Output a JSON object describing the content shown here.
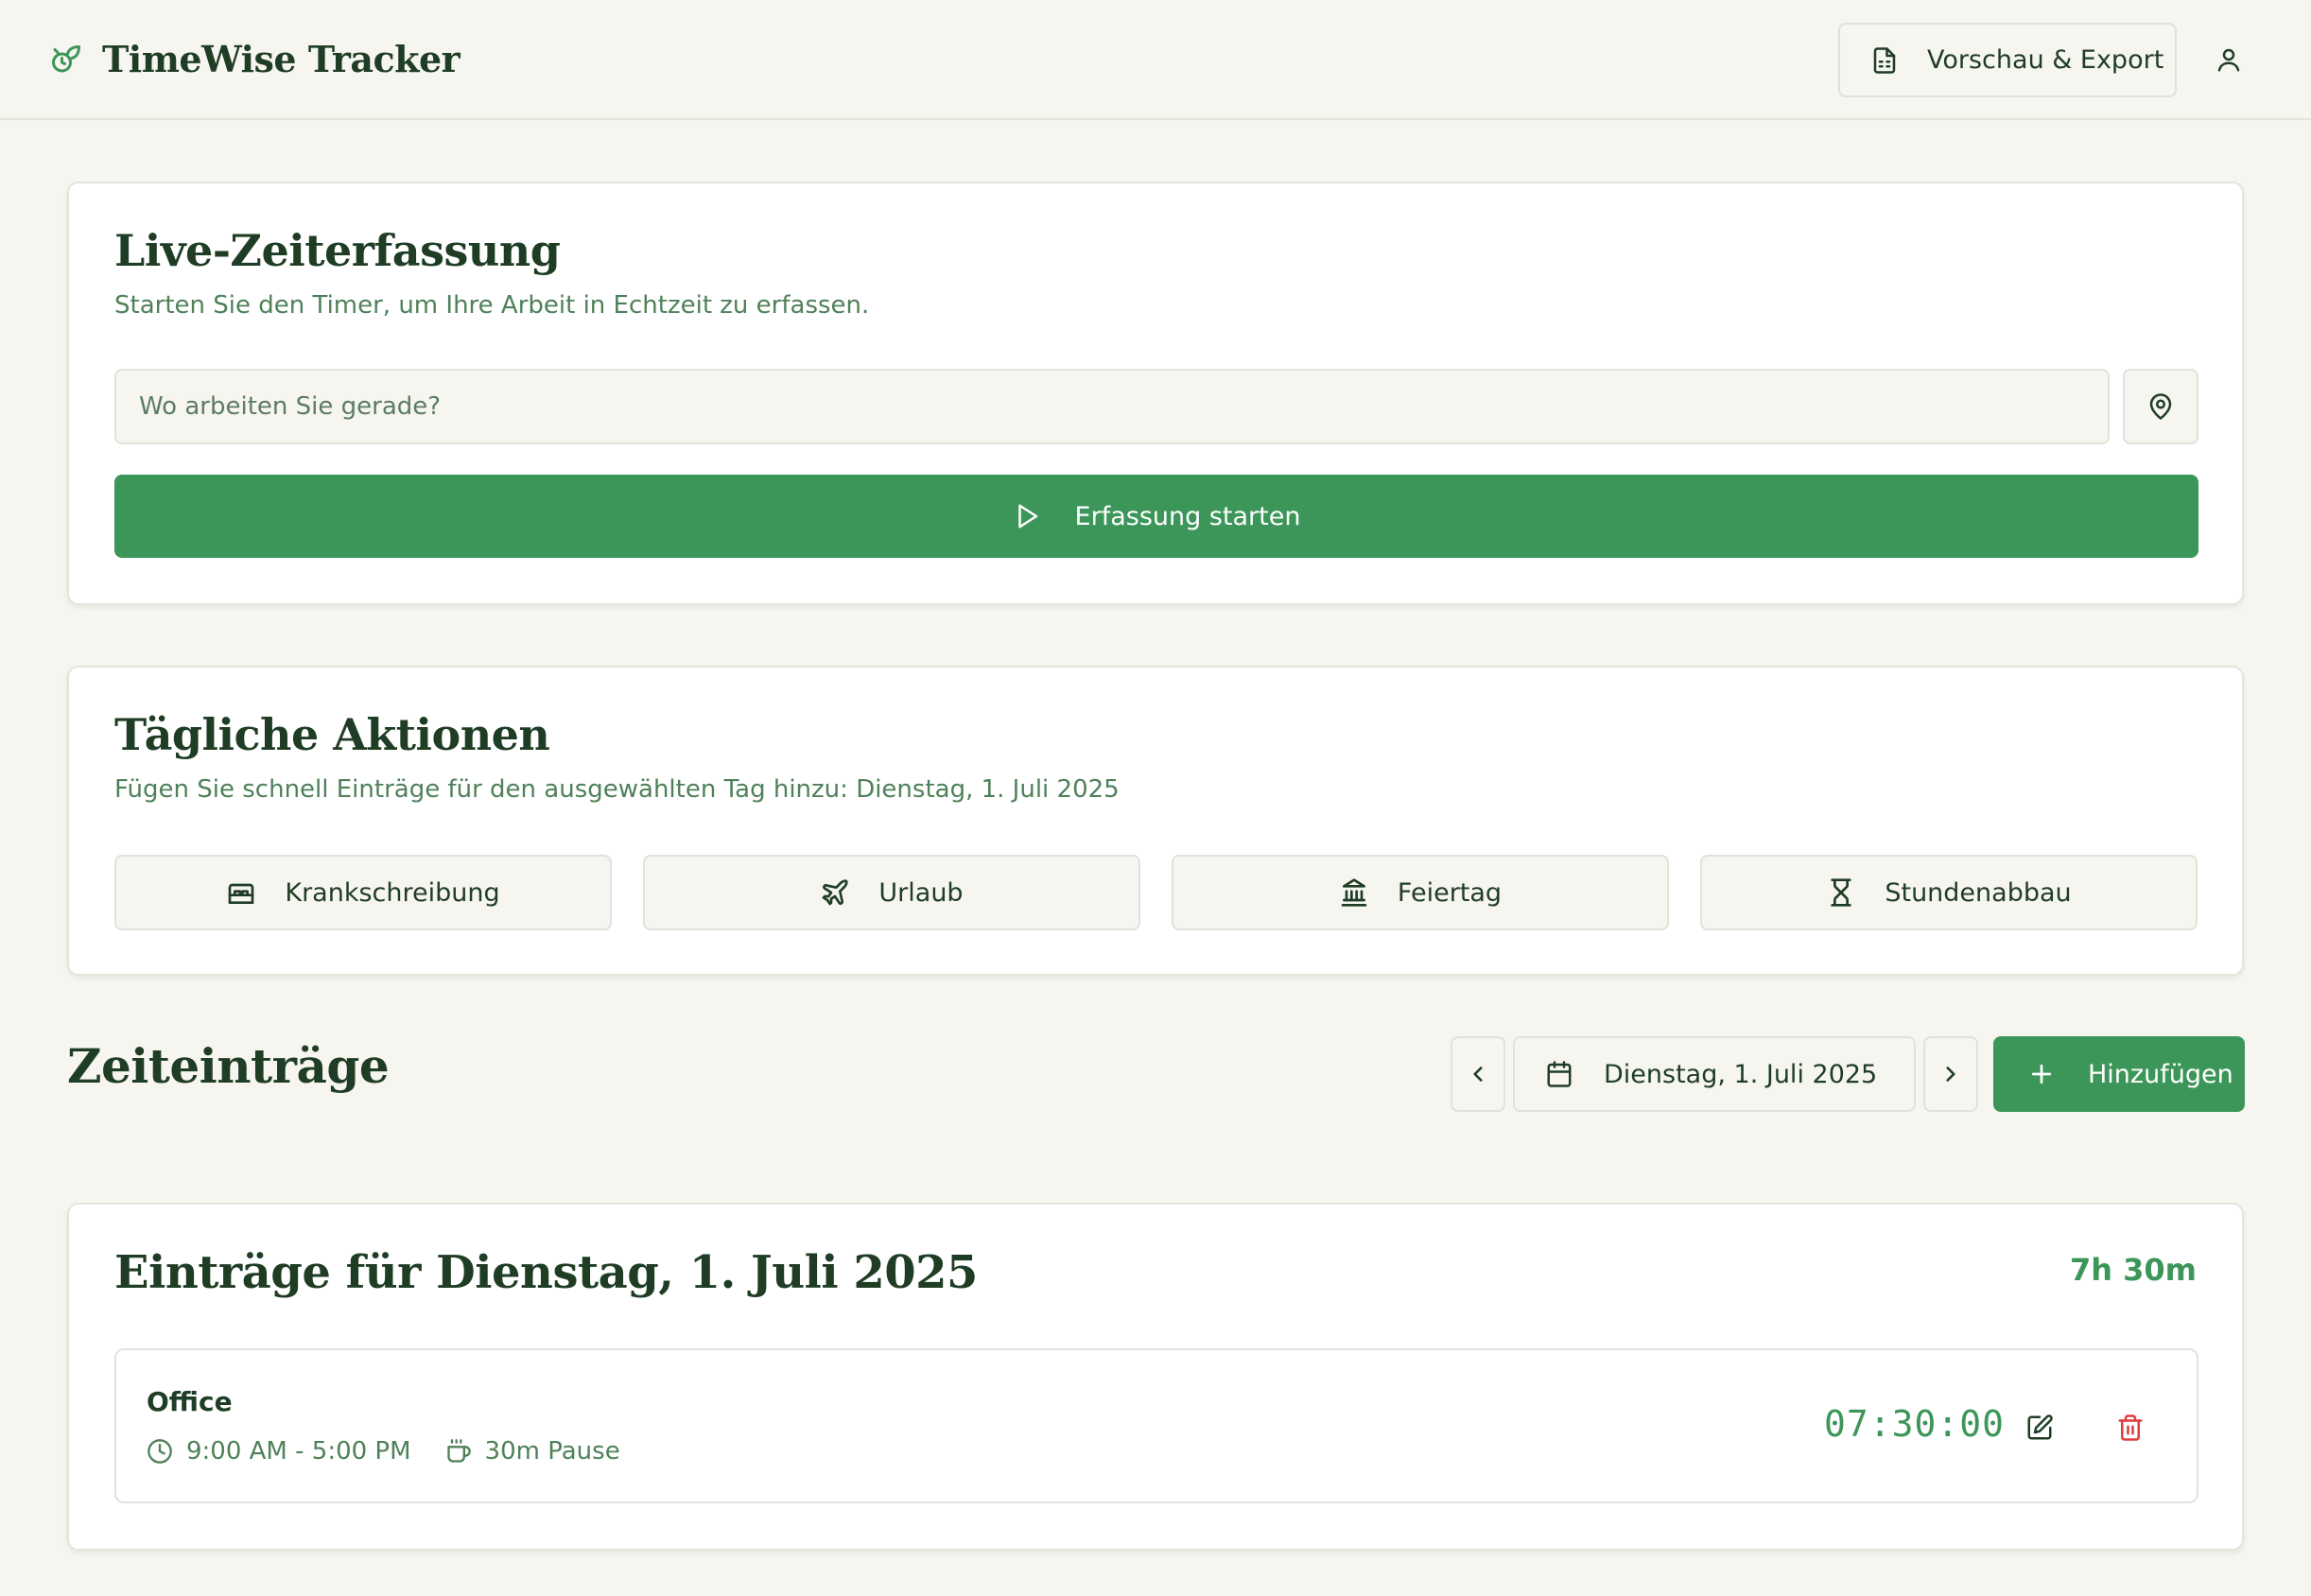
{
  "header": {
    "app_title": "TimeWise Tracker",
    "export_label": "Vorschau & Export",
    "icons": {
      "logo": "sprout-timer-icon",
      "export": "file-text-icon",
      "user": "user-icon"
    }
  },
  "live": {
    "title": "Live-Zeiterfassung",
    "subtitle": "Starten Sie den Timer, um Ihre Arbeit in Echtzeit zu erfassen.",
    "location_placeholder": "Wo arbeiten Sie gerade?",
    "location_value": "",
    "start_label": "Erfassung starten"
  },
  "daily": {
    "title": "Tägliche Aktionen",
    "subtitle": "Fügen Sie schnell Einträge für den ausgewählten Tag hinzu: Dienstag, 1. Juli 2025",
    "actions": [
      {
        "label": "Krankschreibung",
        "icon": "bed-icon"
      },
      {
        "label": "Urlaub",
        "icon": "plane-icon"
      },
      {
        "label": "Feiertag",
        "icon": "landmark-icon"
      },
      {
        "label": "Stundenabbau",
        "icon": "hourglass-icon"
      }
    ]
  },
  "entries_section": {
    "title": "Zeiteinträge",
    "selected_date": "Dienstag, 1. Juli 2025",
    "add_label": "Hinzufügen"
  },
  "day_card": {
    "title": "Einträge für Dienstag, 1. Juli 2025",
    "total": "7h 30m",
    "entries": [
      {
        "location": "Office",
        "time_range": "9:00 AM - 5:00 PM",
        "pause": "30m Pause",
        "duration": "07:30:00"
      }
    ]
  },
  "colors": {
    "accent": "#3c9659",
    "text": "#1f3d24",
    "muted": "#4f8159",
    "background": "#f6f5f0",
    "danger": "#e03b3b"
  }
}
